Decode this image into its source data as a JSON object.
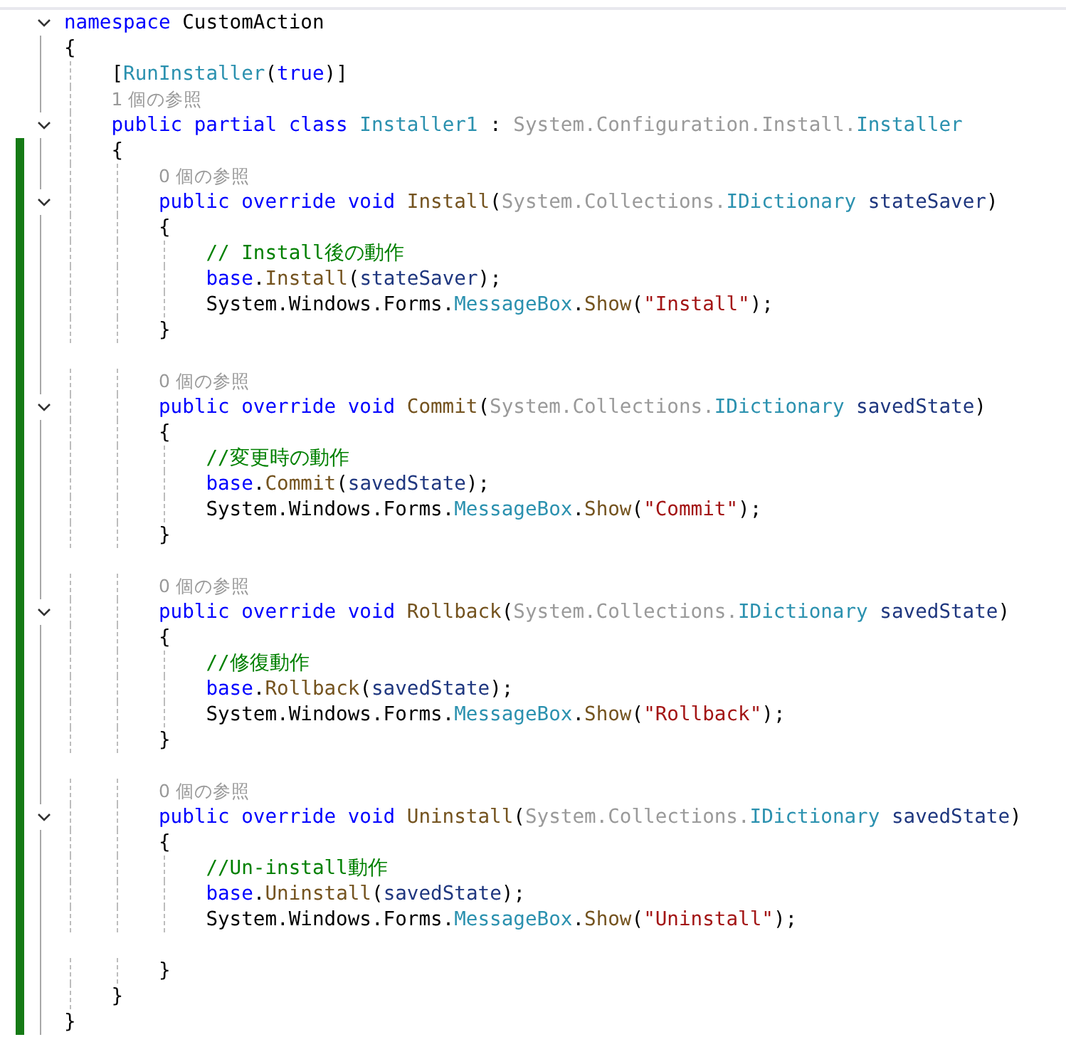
{
  "editor": {
    "lines": [
      {
        "changed": false,
        "expanded": true,
        "tokens": [
          {
            "text": "namespace ",
            "kind": "kw"
          },
          {
            "text": "CustomAction",
            "kind": "plain"
          }
        ]
      },
      {
        "changed": false,
        "tokens": [
          {
            "text": "{",
            "kind": "plain"
          }
        ]
      },
      {
        "changed": false,
        "tokens": [
          {
            "text": "    [",
            "kind": "plain"
          },
          {
            "text": "RunInstaller",
            "kind": "type"
          },
          {
            "text": "(",
            "kind": "plain"
          },
          {
            "text": "true",
            "kind": "kw"
          },
          {
            "text": ")]",
            "kind": "plain"
          }
        ]
      },
      {
        "changed": false,
        "tokens": [
          {
            "text": "    1 個の参照",
            "kind": "codelens"
          }
        ]
      },
      {
        "changed": false,
        "expanded": true,
        "tokens": [
          {
            "text": "    public partial class ",
            "kind": "kw"
          },
          {
            "text": "Installer1",
            "kind": "type"
          },
          {
            "text": " : ",
            "kind": "plain"
          },
          {
            "text": "System.Configuration.Install.",
            "kind": "ns"
          },
          {
            "text": "Installer",
            "kind": "type"
          }
        ]
      },
      {
        "changed": true,
        "tokens": [
          {
            "text": "    {",
            "kind": "plain"
          }
        ]
      },
      {
        "changed": true,
        "tokens": [
          {
            "text": "        0 個の参照",
            "kind": "codelens"
          }
        ]
      },
      {
        "changed": true,
        "expanded": true,
        "tokens": [
          {
            "text": "        public override void ",
            "kind": "kw"
          },
          {
            "text": "Install",
            "kind": "method"
          },
          {
            "text": "(",
            "kind": "plain"
          },
          {
            "text": "System.Collections.",
            "kind": "ns"
          },
          {
            "text": "IDictionary",
            "kind": "type"
          },
          {
            "text": " stateSaver",
            "kind": "param"
          },
          {
            "text": ")",
            "kind": "plain"
          }
        ]
      },
      {
        "changed": true,
        "tokens": [
          {
            "text": "        {",
            "kind": "plain"
          }
        ]
      },
      {
        "changed": true,
        "tokens": [
          {
            "text": "            // Install後の動作",
            "kind": "comment"
          }
        ]
      },
      {
        "changed": true,
        "tokens": [
          {
            "text": "            base",
            "kind": "kw"
          },
          {
            "text": ".",
            "kind": "plain"
          },
          {
            "text": "Install",
            "kind": "method"
          },
          {
            "text": "(",
            "kind": "plain"
          },
          {
            "text": "stateSaver",
            "kind": "param"
          },
          {
            "text": ");",
            "kind": "plain"
          }
        ]
      },
      {
        "changed": true,
        "tokens": [
          {
            "text": "            System.Windows.Forms.",
            "kind": "plain"
          },
          {
            "text": "MessageBox",
            "kind": "type"
          },
          {
            "text": ".",
            "kind": "plain"
          },
          {
            "text": "Show",
            "kind": "method"
          },
          {
            "text": "(",
            "kind": "plain"
          },
          {
            "text": "\"Install\"",
            "kind": "string"
          },
          {
            "text": ");",
            "kind": "plain"
          }
        ]
      },
      {
        "changed": true,
        "tokens": [
          {
            "text": "        }",
            "kind": "plain"
          }
        ]
      },
      {
        "changed": true
      },
      {
        "changed": true,
        "tokens": [
          {
            "text": "        0 個の参照",
            "kind": "codelens"
          }
        ]
      },
      {
        "changed": true,
        "expanded": true,
        "tokens": [
          {
            "text": "        public override void ",
            "kind": "kw"
          },
          {
            "text": "Commit",
            "kind": "method"
          },
          {
            "text": "(",
            "kind": "plain"
          },
          {
            "text": "System.Collections.",
            "kind": "ns"
          },
          {
            "text": "IDictionary",
            "kind": "type"
          },
          {
            "text": " savedState",
            "kind": "param"
          },
          {
            "text": ")",
            "kind": "plain"
          }
        ]
      },
      {
        "changed": true,
        "tokens": [
          {
            "text": "        {",
            "kind": "plain"
          }
        ]
      },
      {
        "changed": true,
        "tokens": [
          {
            "text": "            //変更時の動作",
            "kind": "comment"
          }
        ]
      },
      {
        "changed": true,
        "tokens": [
          {
            "text": "            base",
            "kind": "kw"
          },
          {
            "text": ".",
            "kind": "plain"
          },
          {
            "text": "Commit",
            "kind": "method"
          },
          {
            "text": "(",
            "kind": "plain"
          },
          {
            "text": "savedState",
            "kind": "param"
          },
          {
            "text": ");",
            "kind": "plain"
          }
        ]
      },
      {
        "changed": true,
        "tokens": [
          {
            "text": "            System.Windows.Forms.",
            "kind": "plain"
          },
          {
            "text": "MessageBox",
            "kind": "type"
          },
          {
            "text": ".",
            "kind": "plain"
          },
          {
            "text": "Show",
            "kind": "method"
          },
          {
            "text": "(",
            "kind": "plain"
          },
          {
            "text": "\"Commit\"",
            "kind": "string"
          },
          {
            "text": ");",
            "kind": "plain"
          }
        ]
      },
      {
        "changed": true,
        "tokens": [
          {
            "text": "        }",
            "kind": "plain"
          }
        ]
      },
      {
        "changed": true
      },
      {
        "changed": true,
        "tokens": [
          {
            "text": "        0 個の参照",
            "kind": "codelens"
          }
        ]
      },
      {
        "changed": true,
        "expanded": true,
        "tokens": [
          {
            "text": "        public override void ",
            "kind": "kw"
          },
          {
            "text": "Rollback",
            "kind": "method"
          },
          {
            "text": "(",
            "kind": "plain"
          },
          {
            "text": "System.Collections.",
            "kind": "ns"
          },
          {
            "text": "IDictionary",
            "kind": "type"
          },
          {
            "text": " savedState",
            "kind": "param"
          },
          {
            "text": ")",
            "kind": "plain"
          }
        ]
      },
      {
        "changed": true,
        "tokens": [
          {
            "text": "        {",
            "kind": "plain"
          }
        ]
      },
      {
        "changed": true,
        "tokens": [
          {
            "text": "            //修復動作",
            "kind": "comment"
          }
        ]
      },
      {
        "changed": true,
        "tokens": [
          {
            "text": "            base",
            "kind": "kw"
          },
          {
            "text": ".",
            "kind": "plain"
          },
          {
            "text": "Rollback",
            "kind": "method"
          },
          {
            "text": "(",
            "kind": "plain"
          },
          {
            "text": "savedState",
            "kind": "param"
          },
          {
            "text": ");",
            "kind": "plain"
          }
        ]
      },
      {
        "changed": true,
        "tokens": [
          {
            "text": "            System.Windows.Forms.",
            "kind": "plain"
          },
          {
            "text": "MessageBox",
            "kind": "type"
          },
          {
            "text": ".",
            "kind": "plain"
          },
          {
            "text": "Show",
            "kind": "method"
          },
          {
            "text": "(",
            "kind": "plain"
          },
          {
            "text": "\"Rollback\"",
            "kind": "string"
          },
          {
            "text": ");",
            "kind": "plain"
          }
        ]
      },
      {
        "changed": true,
        "tokens": [
          {
            "text": "        }",
            "kind": "plain"
          }
        ]
      },
      {
        "changed": true
      },
      {
        "changed": true,
        "tokens": [
          {
            "text": "        0 個の参照",
            "kind": "codelens"
          }
        ]
      },
      {
        "changed": true,
        "expanded": true,
        "tokens": [
          {
            "text": "        public override void ",
            "kind": "kw"
          },
          {
            "text": "Uninstall",
            "kind": "method"
          },
          {
            "text": "(",
            "kind": "plain"
          },
          {
            "text": "System.Collections.",
            "kind": "ns"
          },
          {
            "text": "IDictionary",
            "kind": "type"
          },
          {
            "text": " savedState",
            "kind": "param"
          },
          {
            "text": ")",
            "kind": "plain"
          }
        ]
      },
      {
        "changed": true,
        "tokens": [
          {
            "text": "        {",
            "kind": "plain"
          }
        ]
      },
      {
        "changed": true,
        "tokens": [
          {
            "text": "            //Un-install動作",
            "kind": "comment"
          }
        ]
      },
      {
        "changed": true,
        "tokens": [
          {
            "text": "            base",
            "kind": "kw"
          },
          {
            "text": ".",
            "kind": "plain"
          },
          {
            "text": "Uninstall",
            "kind": "method"
          },
          {
            "text": "(",
            "kind": "plain"
          },
          {
            "text": "savedState",
            "kind": "param"
          },
          {
            "text": ");",
            "kind": "plain"
          }
        ]
      },
      {
        "changed": true,
        "tokens": [
          {
            "text": "            System.Windows.Forms.",
            "kind": "plain"
          },
          {
            "text": "MessageBox",
            "kind": "type"
          },
          {
            "text": ".",
            "kind": "plain"
          },
          {
            "text": "Show",
            "kind": "method"
          },
          {
            "text": "(",
            "kind": "plain"
          },
          {
            "text": "\"Uninstall\"",
            "kind": "string"
          },
          {
            "text": ");",
            "kind": "plain"
          }
        ]
      },
      {
        "changed": true
      },
      {
        "changed": true,
        "tokens": [
          {
            "text": "        }",
            "kind": "plain"
          }
        ]
      },
      {
        "changed": true,
        "tokens": [
          {
            "text": "    }",
            "kind": "plain"
          }
        ]
      },
      {
        "changed": true,
        "tokens": [
          {
            "text": "}",
            "kind": "plain"
          }
        ]
      }
    ]
  }
}
